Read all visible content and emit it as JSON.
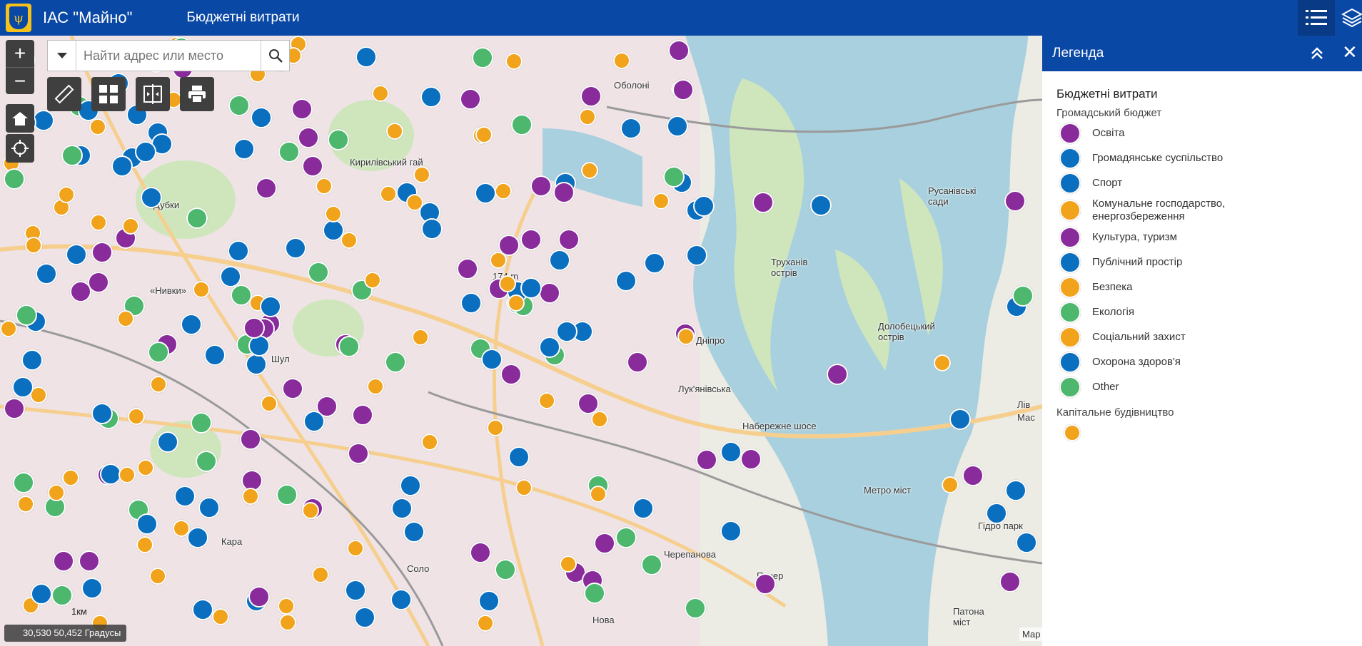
{
  "header": {
    "app_title": "ІАС \"Майно\"",
    "subtitle": "Бюджетні витрати",
    "logo_icon": "kyiv-coat-of-arms-icon",
    "legend_icon": "legend-list-icon",
    "layers_icon": "layers-icon",
    "background_color": "#0a48a5"
  },
  "search": {
    "placeholder": "Найти адрес или место"
  },
  "map": {
    "coordinates": "30,530 50,452 Градусы",
    "scale_label": "1км",
    "attribution": "Мар",
    "labels": [
      "Кирилівський гай",
      "Дубки",
      "«Нивки»",
      "Шул",
      "Русанівські сади",
      "Труханів острів",
      "Долобецький острів",
      "Дніпро",
      "Набережне шосе",
      "Лів",
      "Мас",
      "Гідро парк",
      "Метро міст",
      "Патона міст",
      "Печер",
      "Черепанова",
      "Нова",
      "Соло",
      "Кара",
      "Оболоні",
      "Лук'янівська",
      "174 m"
    ]
  },
  "legend": {
    "header": "Легенда",
    "title": "Бюджетні витрати",
    "group1": "Громадський бюджет",
    "items": [
      {
        "label": "Освіта",
        "color": "#8a2b9c",
        "icon": "graduation-cap-icon"
      },
      {
        "label": "Громадянське суспільство",
        "color": "#0b6fc0",
        "icon": "community-icon"
      },
      {
        "label": "Спорт",
        "color": "#0b6fc0",
        "icon": "sport-icon"
      },
      {
        "label": "Комунальне господарство, енергозбереження",
        "color": "#f1a31c",
        "icon": "utilities-icon"
      },
      {
        "label": "Культура, туризм",
        "color": "#8a2b9c",
        "icon": "culture-icon"
      },
      {
        "label": "Публічний простір",
        "color": "#0b6fc0",
        "icon": "public-space-icon"
      },
      {
        "label": "Безпека",
        "color": "#f1a31c",
        "icon": "warning-icon"
      },
      {
        "label": "Екологія",
        "color": "#4cb76d",
        "icon": "ecology-paw-icon"
      },
      {
        "label": "Соціальний захист",
        "color": "#f1a31c",
        "icon": "social-heart-icon"
      },
      {
        "label": "Охорона здоров'я",
        "color": "#0b6fc0",
        "icon": "health-pill-icon"
      },
      {
        "label": "Other",
        "color": "#4cb76d",
        "icon": "other-icon"
      }
    ],
    "group2": "Капітальне будівництво",
    "group2_color": "#f1a31c"
  }
}
